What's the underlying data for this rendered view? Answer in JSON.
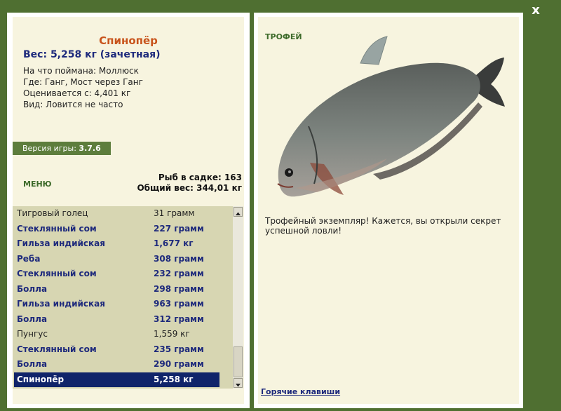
{
  "colors": {
    "background": "#4f6f31",
    "panel": "#f7f4df",
    "title": "#c8541c",
    "accent_blue": "#1e2a7c",
    "selected": "#10246a",
    "list_bg": "#d7d6b2"
  },
  "window": {
    "close_label": "x"
  },
  "fish": {
    "name": "Спинопёр",
    "weight_line": "Вес: 5,258 кг (зачетная)",
    "caught_on": "На что поймана: Моллюск",
    "location": "Где: Ганг, Мост через Ганг",
    "valued_from": "Оценивается с: 4,401 кг",
    "rarity": "Вид: Ловится не часто"
  },
  "version": {
    "label": "Версия игры:",
    "value": "3.7.6"
  },
  "menu_label": "МЕНЮ",
  "stats": {
    "count_line": "Рыб в садке: 163",
    "total_line": "Общий вес: 344,01 кг"
  },
  "catch_list": [
    {
      "name": "Тигровый голец",
      "weight": "31 грамм",
      "style": "normal"
    },
    {
      "name": "Стеклянный сом",
      "weight": "227 грамм",
      "style": "bold"
    },
    {
      "name": "Гильза индийская",
      "weight": "1,677 кг",
      "style": "bold"
    },
    {
      "name": "Реба",
      "weight": "308 грамм",
      "style": "bold"
    },
    {
      "name": "Стеклянный сом",
      "weight": "232 грамм",
      "style": "bold"
    },
    {
      "name": "Болла",
      "weight": "298 грамм",
      "style": "bold"
    },
    {
      "name": "Гильза индийская",
      "weight": "963 грамм",
      "style": "bold"
    },
    {
      "name": "Болла",
      "weight": "312 грамм",
      "style": "bold"
    },
    {
      "name": "Пунгус",
      "weight": "1,559 кг",
      "style": "normal"
    },
    {
      "name": "Стеклянный сом",
      "weight": "235 грамм",
      "style": "bold"
    },
    {
      "name": "Болла",
      "weight": "290 грамм",
      "style": "bold"
    },
    {
      "name": "Спинопёр",
      "weight": "5,258 кг",
      "style": "sel"
    }
  ],
  "trophy": {
    "label": "ТРОФЕЙ",
    "image_icon": "fish-image",
    "description": "Трофейный экземпляр! Кажется, вы открыли секрет успешной ловли!"
  },
  "hotkeys_label": "Горячие клавиши"
}
